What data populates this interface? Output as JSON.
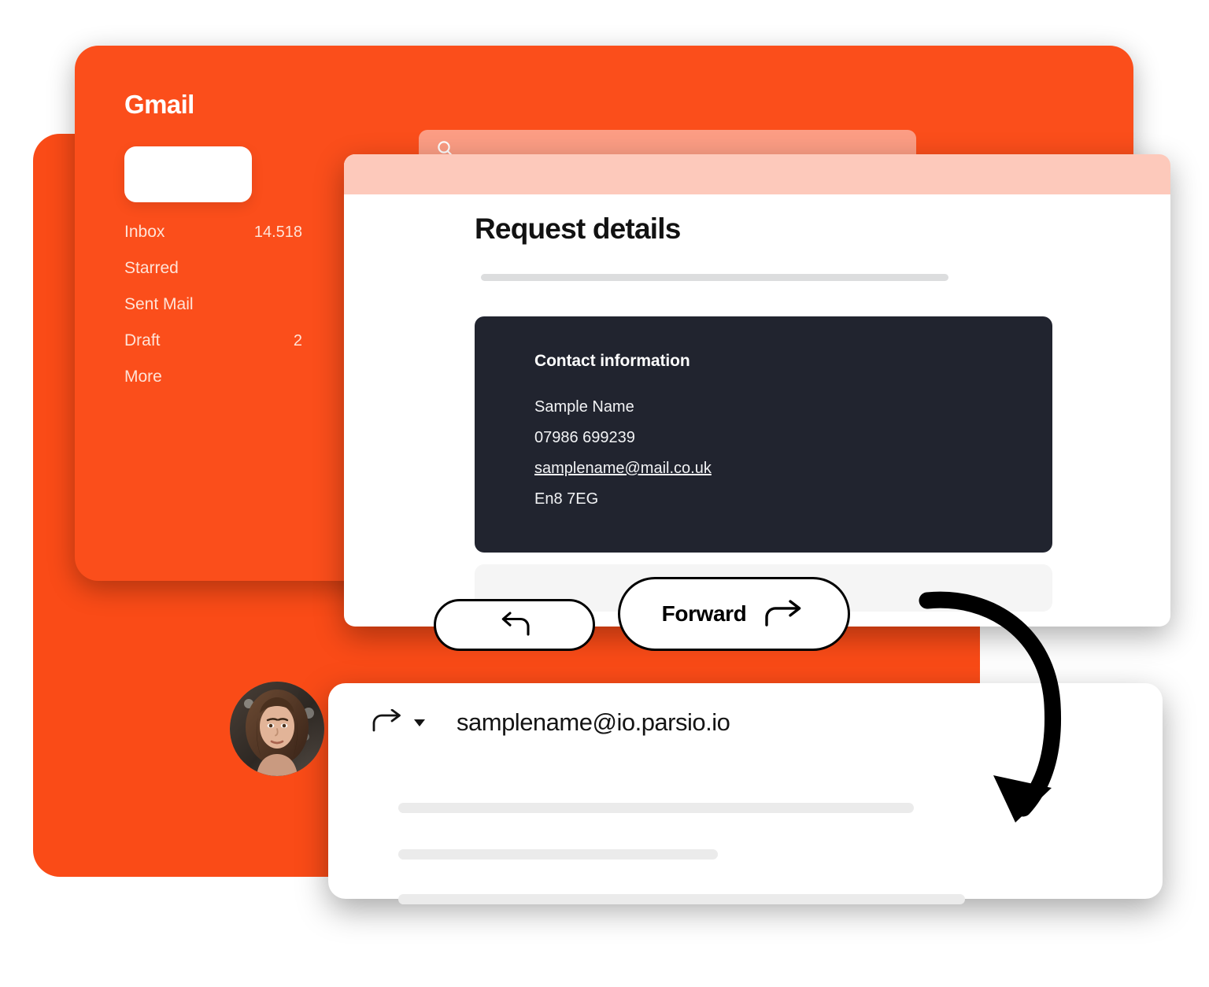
{
  "app": {
    "brand": "Gmail",
    "accent_color": "#FB4E1B",
    "accent_dark_color": "#FA4B17",
    "search_bar_color": "#FC9D84",
    "panel_header_color": "#FDC9BB",
    "contact_card_color": "#21242F",
    "placeholder_color": "#EBEBEB"
  },
  "sidebar": {
    "compose_label": "",
    "items": [
      {
        "label": "Inbox",
        "count": "14.518"
      },
      {
        "label": "Starred",
        "count": ""
      },
      {
        "label": "Sent Mail",
        "count": ""
      },
      {
        "label": "Draft",
        "count": "2"
      },
      {
        "label": "More",
        "count": ""
      }
    ]
  },
  "search": {
    "value": "",
    "placeholder": "",
    "icon": "search-icon"
  },
  "details": {
    "title": "Request details",
    "contact": {
      "heading": "Contact information",
      "name": "Sample Name",
      "phone": "07986 699239",
      "email": "samplename@mail.co.uk",
      "postcode": "En8 7EG"
    }
  },
  "actions": {
    "reply_icon": "reply-arrow-icon",
    "forward_label": "Forward",
    "forward_icon": "forward-arrow-icon"
  },
  "forwarded": {
    "icon": "forward-arrow-icon",
    "dropdown_icon": "chevron-down-icon",
    "address": "samplename@io.parsio.io",
    "body_lines": [
      "",
      "",
      ""
    ]
  },
  "annotation": {
    "arrow_icon": "curved-arrow-icon"
  }
}
